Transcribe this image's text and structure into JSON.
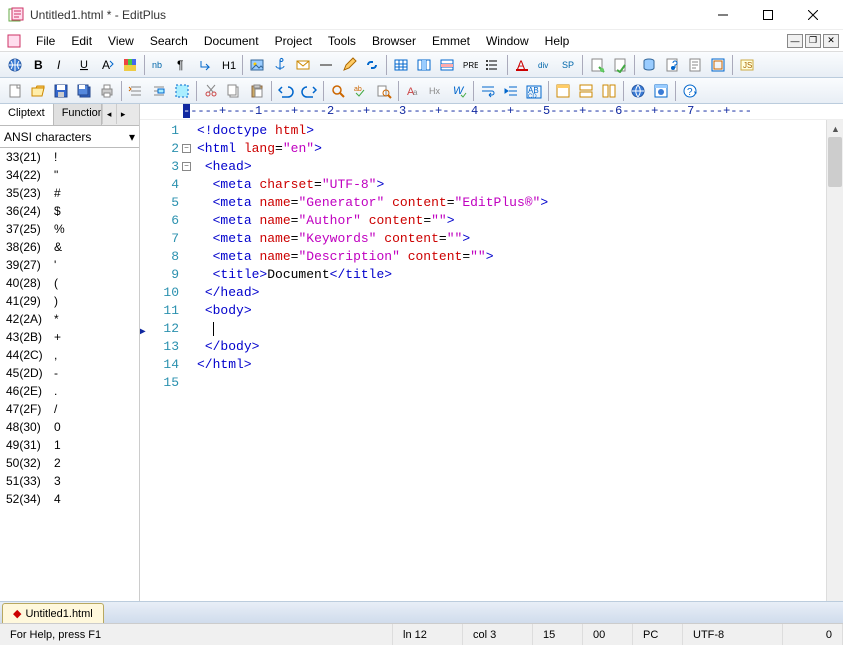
{
  "window": {
    "title": "Untitled1.html * - EditPlus"
  },
  "menubar": [
    "File",
    "Edit",
    "View",
    "Search",
    "Document",
    "Project",
    "Tools",
    "Browser",
    "Emmet",
    "Window",
    "Help"
  ],
  "toolbar1": {
    "items": [
      "globe",
      "bold",
      "italic",
      "underline",
      "font",
      "color",
      "sep",
      "nbsp",
      "para",
      "break",
      "heading",
      "sep",
      "image",
      "anchor",
      "mail",
      "hr",
      "edit",
      "chain",
      "sep",
      "table",
      "td-ins",
      "td-del",
      "pre",
      "list",
      "sep",
      "css",
      "div",
      "sp",
      "sep",
      "create",
      "apply",
      "sep",
      "db",
      "note",
      "text",
      "frame",
      "sep",
      "script"
    ]
  },
  "toolbar2": {
    "items": [
      "new",
      "open",
      "save",
      "saveall",
      "print",
      "sep",
      "fold",
      "fold2",
      "sel-all",
      "sep",
      "cut",
      "copy",
      "paste",
      "sep",
      "undo",
      "redo",
      "sep",
      "search",
      "replace",
      "find-files",
      "sep",
      "word",
      "case",
      "spell",
      "sep",
      "wrap",
      "indent",
      "mark",
      "sep",
      "win1",
      "win2",
      "win3",
      "sep",
      "browser",
      "web",
      "sep",
      "help"
    ]
  },
  "sidebar": {
    "tabs": [
      "Cliptext",
      "Functions"
    ],
    "dropdown": "ANSI characters",
    "items": [
      {
        "code": "33(21)",
        "ch": "!"
      },
      {
        "code": "34(22)",
        "ch": "\""
      },
      {
        "code": "35(23)",
        "ch": "#"
      },
      {
        "code": "36(24)",
        "ch": "$"
      },
      {
        "code": "37(25)",
        "ch": "%"
      },
      {
        "code": "38(26)",
        "ch": "&"
      },
      {
        "code": "39(27)",
        "ch": "'"
      },
      {
        "code": "40(28)",
        "ch": "("
      },
      {
        "code": "41(29)",
        "ch": ")"
      },
      {
        "code": "42(2A)",
        "ch": "*"
      },
      {
        "code": "43(2B)",
        "ch": "+"
      },
      {
        "code": "44(2C)",
        "ch": ","
      },
      {
        "code": "45(2D)",
        "ch": "-"
      },
      {
        "code": "46(2E)",
        "ch": "."
      },
      {
        "code": "47(2F)",
        "ch": "/"
      },
      {
        "code": "48(30)",
        "ch": "0"
      },
      {
        "code": "49(31)",
        "ch": "1"
      },
      {
        "code": "50(32)",
        "ch": "2"
      },
      {
        "code": "51(33)",
        "ch": "3"
      },
      {
        "code": "52(34)",
        "ch": "4"
      }
    ]
  },
  "ruler": "----+----1----+----2----+----3----+----4----+----5----+----6----+----7----+---",
  "code": {
    "lines": [
      {
        "n": 1,
        "html": "<span class='t-tag'>&lt;!doctype</span> <span class='t-attr'>html</span><span class='t-tag'>&gt;</span>"
      },
      {
        "n": 2,
        "fold": "-",
        "html": "<span class='t-tag'>&lt;html</span> <span class='t-attr'>lang</span>=<span class='t-str'>\"en\"</span><span class='t-tag'>&gt;</span>"
      },
      {
        "n": 3,
        "fold": "-",
        "html": " <span class='t-tag'>&lt;head&gt;</span>"
      },
      {
        "n": 4,
        "html": "  <span class='t-tag'>&lt;meta</span> <span class='t-attr'>charset</span>=<span class='t-str'>\"UTF-8\"</span><span class='t-tag'>&gt;</span>"
      },
      {
        "n": 5,
        "html": "  <span class='t-tag'>&lt;meta</span> <span class='t-attr'>name</span>=<span class='t-str'>\"Generator\"</span> <span class='t-attr'>content</span>=<span class='t-str'>\"EditPlus&reg;\"</span><span class='t-tag'>&gt;</span>"
      },
      {
        "n": 6,
        "html": "  <span class='t-tag'>&lt;meta</span> <span class='t-attr'>name</span>=<span class='t-str'>\"Author\"</span> <span class='t-attr'>content</span>=<span class='t-str'>\"\"</span><span class='t-tag'>&gt;</span>"
      },
      {
        "n": 7,
        "html": "  <span class='t-tag'>&lt;meta</span> <span class='t-attr'>name</span>=<span class='t-str'>\"Keywords\"</span> <span class='t-attr'>content</span>=<span class='t-str'>\"\"</span><span class='t-tag'>&gt;</span>"
      },
      {
        "n": 8,
        "html": "  <span class='t-tag'>&lt;meta</span> <span class='t-attr'>name</span>=<span class='t-str'>\"Description\"</span> <span class='t-attr'>content</span>=<span class='t-str'>\"\"</span><span class='t-tag'>&gt;</span>"
      },
      {
        "n": 9,
        "html": "  <span class='t-tag'>&lt;title&gt;</span>Document<span class='t-tag'>&lt;/title&gt;</span>"
      },
      {
        "n": 10,
        "html": " <span class='t-tag'>&lt;/head&gt;</span>"
      },
      {
        "n": 11,
        "html": " <span class='t-tag'>&lt;body&gt;</span>"
      },
      {
        "n": 12,
        "caret": true,
        "html": "  <span class='caret'></span>"
      },
      {
        "n": 13,
        "html": " <span class='t-tag'>&lt;/body&gt;</span>"
      },
      {
        "n": 14,
        "html": "<span class='t-tag'>&lt;/html&gt;</span>"
      },
      {
        "n": 15,
        "html": ""
      }
    ]
  },
  "doctab": {
    "label": "Untitled1.html",
    "modified": true
  },
  "statusbar": {
    "help": "For Help, press F1",
    "line": "ln 12",
    "col": "col 3",
    "lines": "15",
    "sel": "00",
    "mode": "PC",
    "encoding": "UTF-8",
    "zoom": "0"
  }
}
